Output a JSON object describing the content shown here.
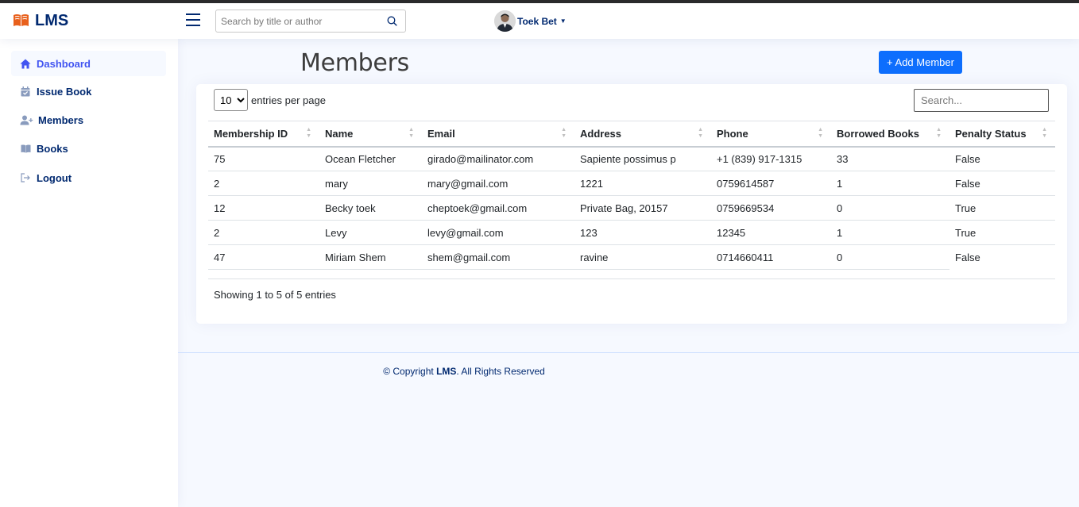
{
  "app": {
    "logo_text": "LMS"
  },
  "search": {
    "placeholder": "Search by title or author"
  },
  "profile": {
    "name": "Toek Bet"
  },
  "sidebar": {
    "items": [
      {
        "label": "Dashboard",
        "icon": "house-icon"
      },
      {
        "label": "Issue Book",
        "icon": "calendar-check-icon"
      },
      {
        "label": "Members",
        "icon": "person-add-icon"
      },
      {
        "label": "Books",
        "icon": "book-icon"
      },
      {
        "label": "Logout",
        "icon": "logout-icon"
      }
    ]
  },
  "page": {
    "title": "Members",
    "add_button": "+ Add Member"
  },
  "table_controls": {
    "page_size": "10",
    "entries_label": "entries per page",
    "search_placeholder": "Search..."
  },
  "table": {
    "headers": [
      "Membership ID",
      "Name",
      "Email",
      "Address",
      "Phone",
      "Borrowed Books",
      "Penalty Status"
    ],
    "rows": [
      [
        "75",
        "Ocean Fletcher",
        "girado@mailinator.com",
        "Sapiente possimus p",
        "+1 (839) 917-1315",
        "33",
        "False"
      ],
      [
        "2",
        "mary",
        "mary@gmail.com",
        "1221",
        "0759614587",
        "1",
        "False"
      ],
      [
        "12",
        "Becky toek",
        "cheptoek@gmail.com",
        "Private Bag, 20157",
        "0759669534",
        "0",
        "True"
      ],
      [
        "2",
        "Levy",
        "levy@gmail.com",
        "123",
        "12345",
        "1",
        "True"
      ],
      [
        "47",
        "Miriam Shem",
        "shem@gmail.com",
        "ravine",
        "0714660411",
        "0",
        "False"
      ]
    ],
    "info": "Showing 1 to 5 of 5 entries"
  },
  "footer": {
    "prefix": "© Copyright ",
    "brand": "LMS",
    "suffix": ". All Rights Reserved"
  },
  "colors": {
    "brand": "#012970",
    "accent": "#4154f1",
    "primary_button": "#0d6efd",
    "logo_orange": "#e8601c"
  }
}
